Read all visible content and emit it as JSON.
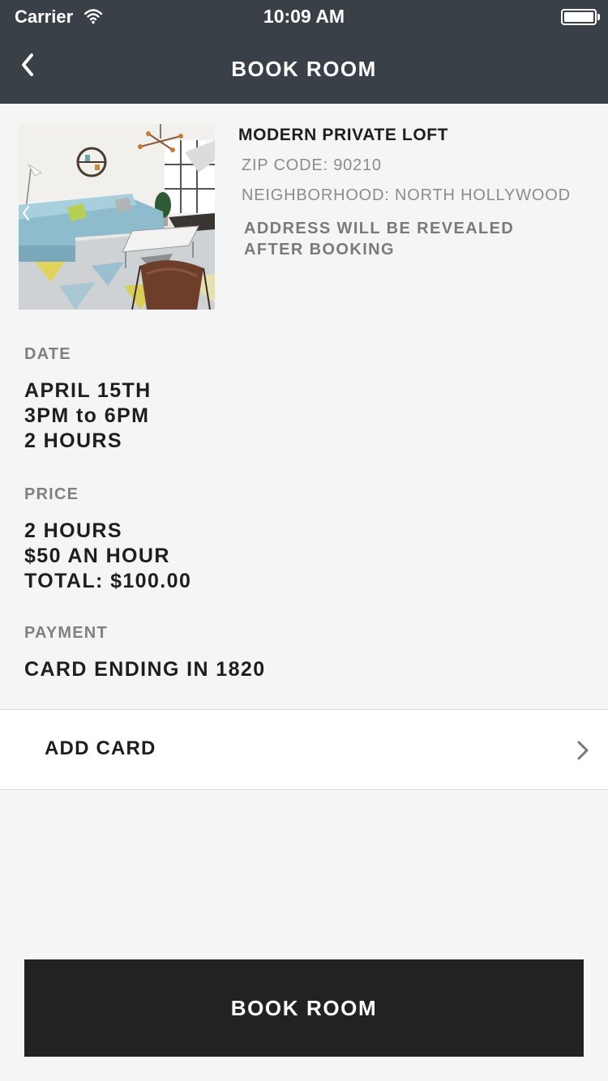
{
  "status_bar": {
    "carrier": "Carrier",
    "time": "10:09 AM",
    "wifi_icon": "wifi-icon",
    "battery_icon": "battery-full-icon"
  },
  "nav": {
    "back_icon": "chevron-left-icon",
    "title": "BOOK ROOM"
  },
  "listing": {
    "name": "MODERN PRIVATE LOFT",
    "zip": "ZIP CODE: 90210",
    "neighborhood": "NEIGHBORHOOD: NORTH HOLLYWOOD",
    "address_line1": "ADDRESS WILL BE REVEALED",
    "address_line2": "AFTER BOOKING"
  },
  "date": {
    "label": "DATE",
    "lines": [
      "APRIL 15TH",
      "3PM to 6PM",
      "2 HOURS"
    ]
  },
  "price": {
    "label": "PRICE",
    "lines": [
      "2 HOURS",
      "$50 AN HOUR",
      "TOTAL: $100.00"
    ]
  },
  "payment": {
    "label": "PAYMENT",
    "card": "CARD ENDING IN 1820"
  },
  "add_card": {
    "label": "ADD CARD",
    "icon": "chevron-right-icon"
  },
  "book_button": {
    "label": "BOOK ROOM"
  },
  "colors": {
    "nav_background": "#3a4048",
    "page_background": "#f5f5f5",
    "button_background": "#222222",
    "muted_text": "#8c8c8c"
  }
}
